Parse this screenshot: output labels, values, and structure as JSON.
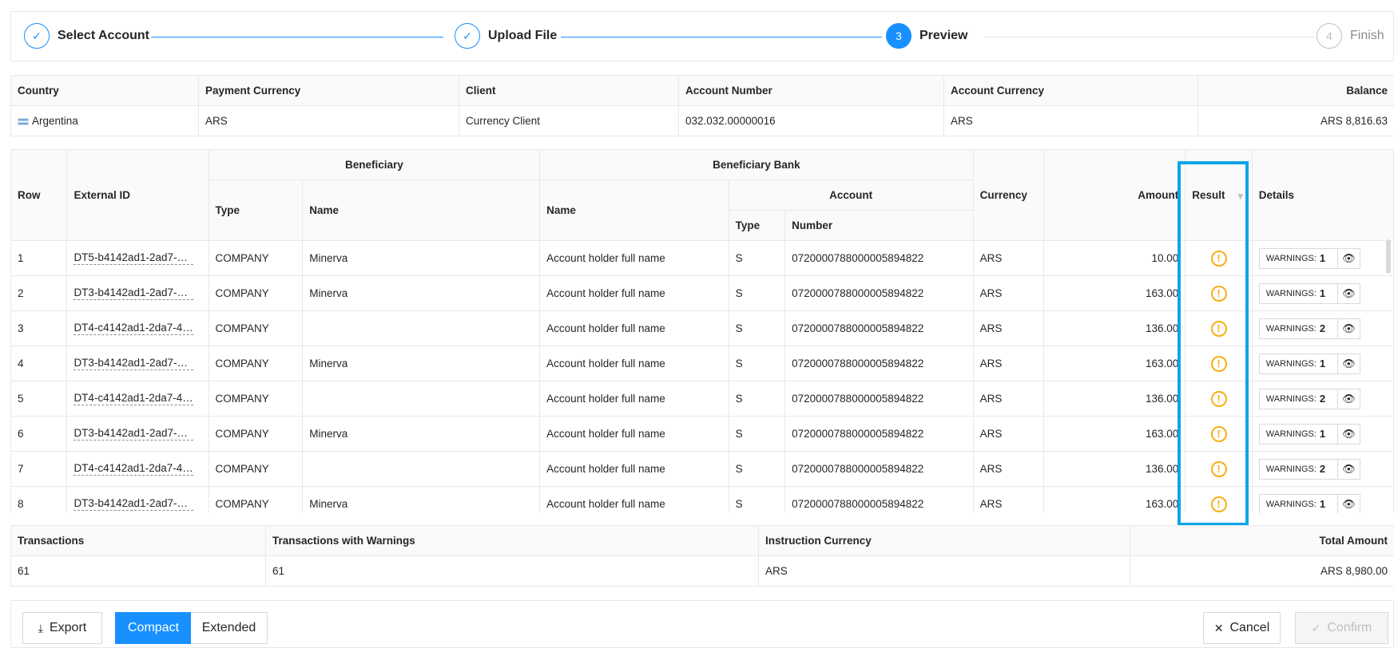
{
  "steps": [
    {
      "label": "Select Account",
      "status": "done",
      "icon": "check-icon"
    },
    {
      "label": "Upload File",
      "status": "done",
      "icon": "check-icon"
    },
    {
      "label": "Preview",
      "status": "active",
      "number": "3"
    },
    {
      "label": "Finish",
      "status": "wait",
      "number": "4"
    }
  ],
  "account_info": {
    "headers": [
      "Country",
      "Payment Currency",
      "Client",
      "Account Number",
      "Account Currency",
      "Balance"
    ],
    "values": [
      "Argentina",
      "ARS",
      "Currency Client",
      "032.032.00000016",
      "ARS",
      "ARS 8,816.63"
    ]
  },
  "transactions_table": {
    "headers": {
      "row": "Row",
      "external_id": "External ID",
      "beneficiary": "Beneficiary",
      "beneficiary_type": "Type",
      "beneficiary_name": "Name",
      "beneficiary_bank": "Beneficiary Bank",
      "bank_name": "Name",
      "account": "Account",
      "account_type": "Type",
      "account_number": "Number",
      "currency": "Currency",
      "amount": "Amount",
      "result": "Result",
      "details": "Details"
    },
    "warnings_label": "WARNINGS:",
    "rows": [
      {
        "row": "1",
        "external_id": "DT5-b4142ad1-2ad7-47...",
        "type": "COMPANY",
        "name": "Minerva",
        "bank_name": "Account holder full name",
        "account_type": "S",
        "account_number": "0720000788000005894822",
        "currency": "ARS",
        "amount": "10.00",
        "warnings": "1"
      },
      {
        "row": "2",
        "external_id": "DT3-b4142ad1-2ad7-47...",
        "type": "COMPANY",
        "name": "Minerva",
        "bank_name": "Account holder full name",
        "account_type": "S",
        "account_number": "0720000788000005894822",
        "currency": "ARS",
        "amount": "163.00",
        "warnings": "1"
      },
      {
        "row": "3",
        "external_id": "DT4-c4142ad1-2da7-47...",
        "type": "COMPANY",
        "name": "",
        "bank_name": "Account holder full name",
        "account_type": "S",
        "account_number": "0720000788000005894822",
        "currency": "ARS",
        "amount": "136.00",
        "warnings": "2"
      },
      {
        "row": "4",
        "external_id": "DT3-b4142ad1-2ad7-47...",
        "type": "COMPANY",
        "name": "Minerva",
        "bank_name": "Account holder full name",
        "account_type": "S",
        "account_number": "0720000788000005894822",
        "currency": "ARS",
        "amount": "163.00",
        "warnings": "1"
      },
      {
        "row": "5",
        "external_id": "DT4-c4142ad1-2da7-47...",
        "type": "COMPANY",
        "name": "",
        "bank_name": "Account holder full name",
        "account_type": "S",
        "account_number": "0720000788000005894822",
        "currency": "ARS",
        "amount": "136.00",
        "warnings": "2"
      },
      {
        "row": "6",
        "external_id": "DT3-b4142ad1-2ad7-47...",
        "type": "COMPANY",
        "name": "Minerva",
        "bank_name": "Account holder full name",
        "account_type": "S",
        "account_number": "0720000788000005894822",
        "currency": "ARS",
        "amount": "163.00",
        "warnings": "1"
      },
      {
        "row": "7",
        "external_id": "DT4-c4142ad1-2da7-47...",
        "type": "COMPANY",
        "name": "",
        "bank_name": "Account holder full name",
        "account_type": "S",
        "account_number": "0720000788000005894822",
        "currency": "ARS",
        "amount": "136.00",
        "warnings": "2"
      },
      {
        "row": "8",
        "external_id": "DT3-b4142ad1-2ad7-47...",
        "type": "COMPANY",
        "name": "Minerva",
        "bank_name": "Account holder full name",
        "account_type": "S",
        "account_number": "0720000788000005894822",
        "currency": "ARS",
        "amount": "163.00",
        "warnings": "1"
      }
    ]
  },
  "summary": {
    "headers": [
      "Transactions",
      "Transactions with Warnings",
      "Instruction Currency",
      "Total Amount"
    ],
    "values": [
      "61",
      "61",
      "ARS",
      "ARS 8,980.00"
    ]
  },
  "footer": {
    "export_label": "Export",
    "compact_label": "Compact",
    "extended_label": "Extended",
    "cancel_label": "Cancel",
    "confirm_label": "Confirm"
  },
  "colors": {
    "primary": "#1890ff",
    "warning": "#faad14",
    "highlight": "#0ea5e9"
  }
}
